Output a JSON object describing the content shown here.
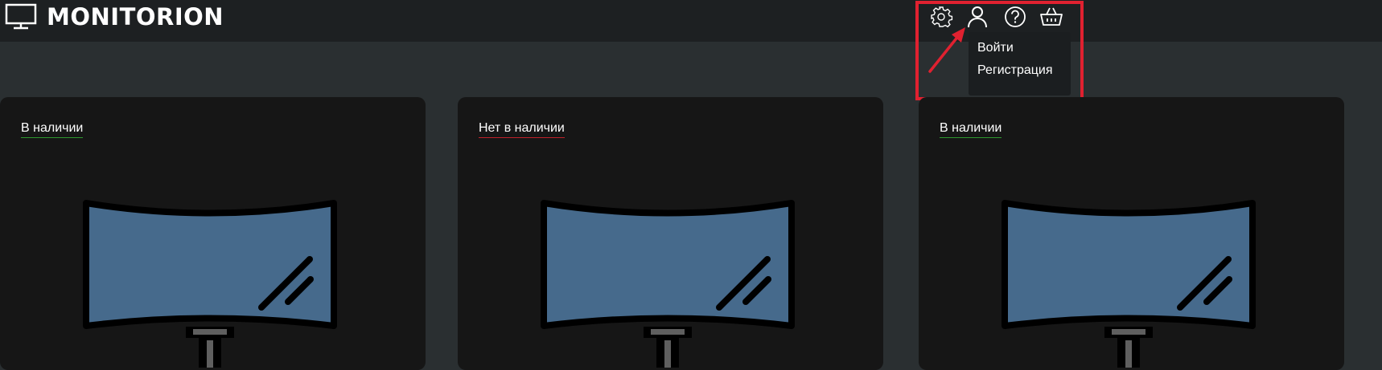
{
  "app": {
    "title": "MONITORION"
  },
  "header": {
    "icons": [
      "gear-icon",
      "user-icon",
      "help-icon",
      "basket-icon"
    ]
  },
  "user_menu": {
    "items": [
      {
        "label": "Войти"
      },
      {
        "label": "Регистрация"
      }
    ]
  },
  "cards": [
    {
      "status": "В наличии",
      "status_color": "#2e9a2e"
    },
    {
      "status": "Нет в наличии",
      "status_color": "#c0202a"
    },
    {
      "status": "В наличии",
      "status_color": "#2e9a2e"
    }
  ],
  "colors": {
    "header_bg": "#1d2022",
    "page_bg": "#2a2f31",
    "card_bg": "#161616",
    "annotation": "#e02130",
    "screen": "#466a8c"
  }
}
